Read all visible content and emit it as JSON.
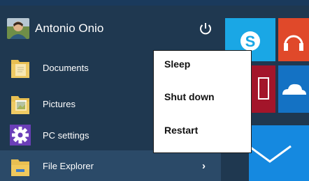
{
  "user": {
    "name": "Antonio Onio"
  },
  "menu_items": [
    {
      "label": "Documents",
      "icon": "folder-documents-icon"
    },
    {
      "label": "Pictures",
      "icon": "folder-pictures-icon"
    },
    {
      "label": "PC settings",
      "icon": "gear-icon"
    },
    {
      "label": "File Explorer",
      "icon": "folder-explorer-icon"
    }
  ],
  "file_explorer_chevron": "›",
  "power_menu": {
    "sleep_label": "Sleep",
    "shutdown_label": "Shut down",
    "restart_label": "Restart"
  },
  "tiles": [
    "skype-icon",
    "headphones-icon",
    "tablet-icon",
    "onedrive-cloud-icon",
    "mail-icon"
  ],
  "colors": {
    "menu_bg": "#1f3850",
    "skype": "#1aa7e5",
    "music": "#e0492a",
    "red_tile": "#a3152a",
    "onedrive": "#1472c4",
    "mail": "#1589e0"
  }
}
